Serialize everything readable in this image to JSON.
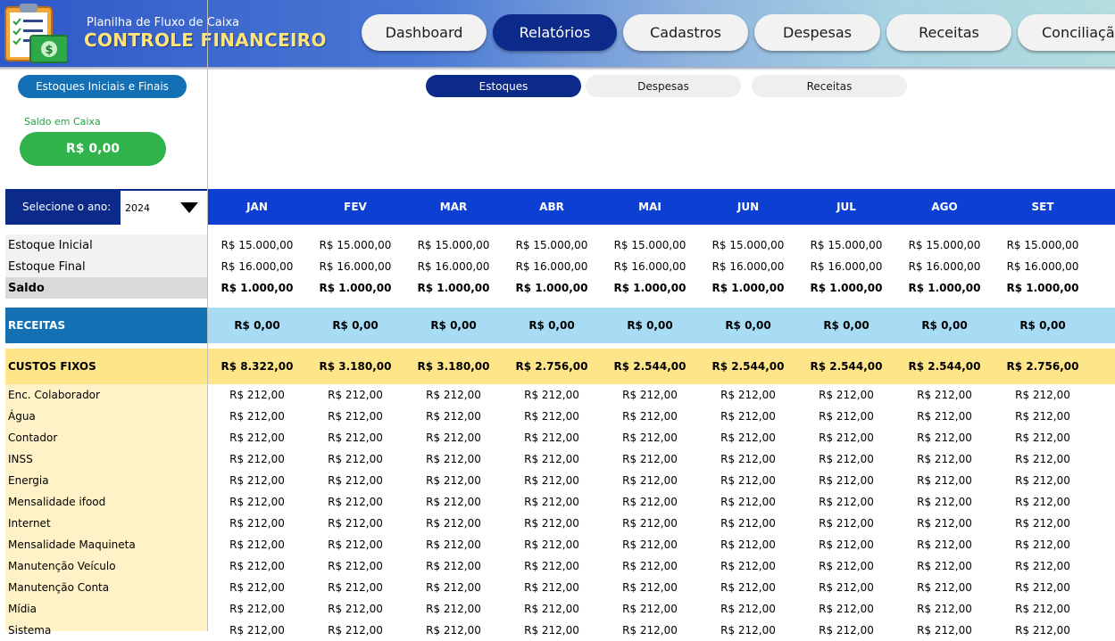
{
  "header": {
    "subtitle": "Planilha de Fluxo de Caixa",
    "title": "CONTROLE FINANCEIRO"
  },
  "nav": [
    {
      "label": "Dashboard",
      "active": false
    },
    {
      "label": "Relatórios",
      "active": true
    },
    {
      "label": "Cadastros",
      "active": false
    },
    {
      "label": "Despesas",
      "active": false
    },
    {
      "label": "Receitas",
      "active": false
    },
    {
      "label": "Conciliação",
      "active": false
    }
  ],
  "sidebar": {
    "estoques_button": "Estoques Iniciais e Finais",
    "saldo_label": "Saldo em Caixa",
    "saldo_value": "R$ 0,00"
  },
  "subtabs": [
    {
      "label": "Estoques",
      "active": true
    },
    {
      "label": "Despesas",
      "active": false
    },
    {
      "label": "Receitas",
      "active": false
    }
  ],
  "year_selector": {
    "label": "Selecione o ano:",
    "value": "2024"
  },
  "months": [
    "JAN",
    "FEV",
    "MAR",
    "ABR",
    "MAI",
    "JUN",
    "JUL",
    "AGO",
    "SET"
  ],
  "stock": {
    "inicial": {
      "label": "Estoque Inicial",
      "values": [
        "R$ 15.000,00",
        "R$ 15.000,00",
        "R$ 15.000,00",
        "R$ 15.000,00",
        "R$ 15.000,00",
        "R$ 15.000,00",
        "R$ 15.000,00",
        "R$ 15.000,00",
        "R$ 15.000,00"
      ]
    },
    "final": {
      "label": "Estoque Final",
      "values": [
        "R$ 16.000,00",
        "R$ 16.000,00",
        "R$ 16.000,00",
        "R$ 16.000,00",
        "R$ 16.000,00",
        "R$ 16.000,00",
        "R$ 16.000,00",
        "R$ 16.000,00",
        "R$ 16.000,00"
      ]
    },
    "saldo": {
      "label": "Saldo",
      "values": [
        "R$ 1.000,00",
        "R$ 1.000,00",
        "R$ 1.000,00",
        "R$ 1.000,00",
        "R$ 1.000,00",
        "R$ 1.000,00",
        "R$ 1.000,00",
        "R$ 1.000,00",
        "R$ 1.000,00"
      ]
    }
  },
  "receitas": {
    "label": "RECEITAS",
    "values": [
      "R$ 0,00",
      "R$ 0,00",
      "R$ 0,00",
      "R$ 0,00",
      "R$ 0,00",
      "R$ 0,00",
      "R$ 0,00",
      "R$ 0,00",
      "R$ 0,00"
    ]
  },
  "custos_fixos": {
    "label": "CUSTOS FIXOS",
    "values": [
      "R$ 8.322,00",
      "R$ 3.180,00",
      "R$ 3.180,00",
      "R$ 2.756,00",
      "R$ 2.544,00",
      "R$ 2.544,00",
      "R$ 2.544,00",
      "R$ 2.544,00",
      "R$ 2.756,00"
    ],
    "items": [
      {
        "label": "Enc. Colaborador",
        "values": [
          "R$ 212,00",
          "R$ 212,00",
          "R$ 212,00",
          "R$ 212,00",
          "R$ 212,00",
          "R$ 212,00",
          "R$ 212,00",
          "R$ 212,00",
          "R$ 212,00"
        ]
      },
      {
        "label": "Água",
        "values": [
          "R$ 212,00",
          "R$ 212,00",
          "R$ 212,00",
          "R$ 212,00",
          "R$ 212,00",
          "R$ 212,00",
          "R$ 212,00",
          "R$ 212,00",
          "R$ 212,00"
        ]
      },
      {
        "label": "Contador",
        "values": [
          "R$ 212,00",
          "R$ 212,00",
          "R$ 212,00",
          "R$ 212,00",
          "R$ 212,00",
          "R$ 212,00",
          "R$ 212,00",
          "R$ 212,00",
          "R$ 212,00"
        ]
      },
      {
        "label": "INSS",
        "values": [
          "R$ 212,00",
          "R$ 212,00",
          "R$ 212,00",
          "R$ 212,00",
          "R$ 212,00",
          "R$ 212,00",
          "R$ 212,00",
          "R$ 212,00",
          "R$ 212,00"
        ]
      },
      {
        "label": "Energia",
        "values": [
          "R$ 212,00",
          "R$ 212,00",
          "R$ 212,00",
          "R$ 212,00",
          "R$ 212,00",
          "R$ 212,00",
          "R$ 212,00",
          "R$ 212,00",
          "R$ 212,00"
        ]
      },
      {
        "label": "Mensalidade ifood",
        "values": [
          "R$ 212,00",
          "R$ 212,00",
          "R$ 212,00",
          "R$ 212,00",
          "R$ 212,00",
          "R$ 212,00",
          "R$ 212,00",
          "R$ 212,00",
          "R$ 212,00"
        ]
      },
      {
        "label": "Internet",
        "values": [
          "R$ 212,00",
          "R$ 212,00",
          "R$ 212,00",
          "R$ 212,00",
          "R$ 212,00",
          "R$ 212,00",
          "R$ 212,00",
          "R$ 212,00",
          "R$ 212,00"
        ]
      },
      {
        "label": "Mensalidade Maquineta",
        "values": [
          "R$ 212,00",
          "R$ 212,00",
          "R$ 212,00",
          "R$ 212,00",
          "R$ 212,00",
          "R$ 212,00",
          "R$ 212,00",
          "R$ 212,00",
          "R$ 212,00"
        ]
      },
      {
        "label": "Manutenção Veículo",
        "values": [
          "R$ 212,00",
          "R$ 212,00",
          "R$ 212,00",
          "R$ 212,00",
          "R$ 212,00",
          "R$ 212,00",
          "R$ 212,00",
          "R$ 212,00",
          "R$ 212,00"
        ]
      },
      {
        "label": "Manutenção Conta",
        "values": [
          "R$ 212,00",
          "R$ 212,00",
          "R$ 212,00",
          "R$ 212,00",
          "R$ 212,00",
          "R$ 212,00",
          "R$ 212,00",
          "R$ 212,00",
          "R$ 212,00"
        ]
      },
      {
        "label": "Mídia",
        "values": [
          "R$ 212,00",
          "R$ 212,00",
          "R$ 212,00",
          "R$ 212,00",
          "R$ 212,00",
          "R$ 212,00",
          "R$ 212,00",
          "R$ 212,00",
          "R$ 212,00"
        ]
      },
      {
        "label": "Sistema",
        "values": [
          "R$ 212,00",
          "R$ 212,00",
          "R$ 212,00",
          "R$ 212,00",
          "R$ 212,00",
          "R$ 212,00",
          "R$ 212,00",
          "R$ 212,00",
          "R$ 212,00"
        ]
      }
    ]
  },
  "colors": {
    "header_blue": "#2f58c8",
    "nav_active": "#0b2a8a",
    "month_bar": "#0e3fd3",
    "receitas_label_bg": "#1472b4",
    "receitas_row_bg": "#a8dcf4",
    "custos_row_bg": "#ffe58a",
    "custos_items_bg": "#fff2c6",
    "stock_label_bg": "#f2f2f2",
    "saldo_green": "#2fb34a"
  }
}
